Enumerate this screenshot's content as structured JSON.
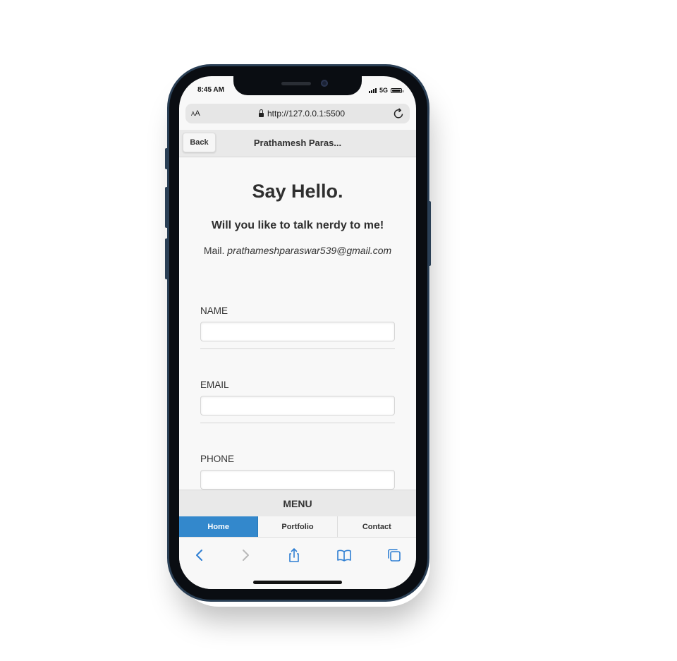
{
  "status_bar": {
    "time": "8:45 AM",
    "network": "5G"
  },
  "browser": {
    "text_size_small": "A",
    "text_size_large": "A",
    "url": "http://127.0.0.1:5500"
  },
  "header": {
    "back_label": "Back",
    "title": "Prathamesh Paras..."
  },
  "main": {
    "heading": "Say Hello.",
    "subheading": "Will you like to talk nerdy to me!",
    "mail_label": "Mail.",
    "mail_address": "prathameshparaswar539@gmail.com"
  },
  "form": {
    "name_label": "NAME",
    "email_label": "EMAIL",
    "phone_label": "PHONE",
    "name_value": "",
    "email_value": "",
    "phone_value": ""
  },
  "menu": {
    "title": "MENU",
    "tabs": [
      {
        "label": "Home",
        "active": true
      },
      {
        "label": "Portfolio",
        "active": false
      },
      {
        "label": "Contact",
        "active": false
      }
    ]
  },
  "toolbar_icons": [
    "back-arrow-icon",
    "forward-arrow-icon",
    "share-icon",
    "bookmarks-icon",
    "tabs-icon"
  ],
  "colors": {
    "accent": "#3388cc",
    "ios_blue": "#2f7fd3"
  }
}
